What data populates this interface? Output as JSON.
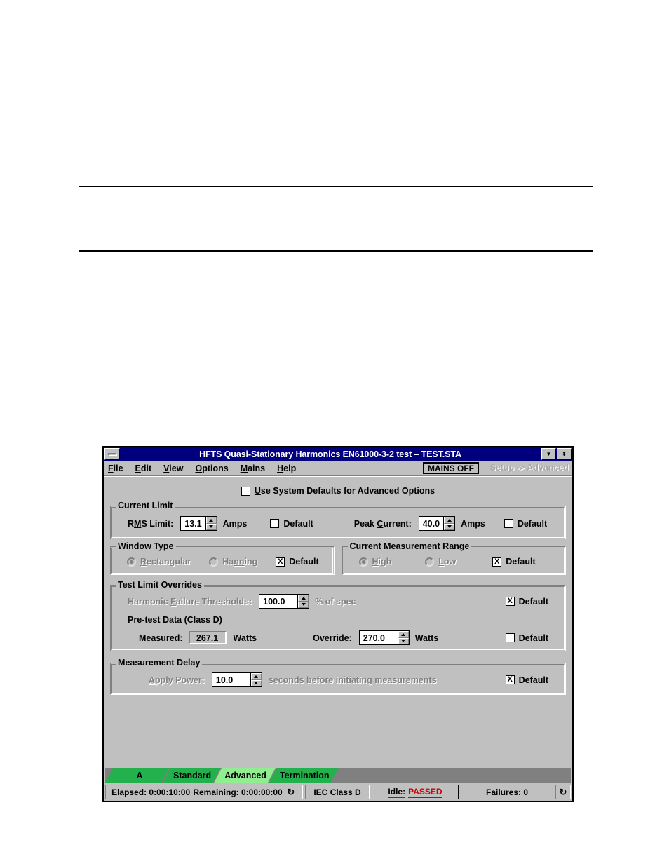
{
  "window": {
    "title": "HFTS Quasi-Stationary Harmonics EN61000-3-2 test – TEST.STA",
    "sysmenu_icon": "system-menu-icon",
    "minimize_icon": "▼",
    "restore_icon": "⬍"
  },
  "menubar": {
    "items": [
      {
        "label": "File",
        "accel": "F"
      },
      {
        "label": "Edit",
        "accel": "E"
      },
      {
        "label": "View",
        "accel": "V"
      },
      {
        "label": "Options",
        "accel": "O"
      },
      {
        "label": "Mains",
        "accel": "M"
      },
      {
        "label": "Help",
        "accel": "H"
      }
    ],
    "mains_button": "MAINS OFF",
    "breadcrumb": "Setup -> Advanced"
  },
  "system_defaults": {
    "label": "Use System Defaults for Advanced Options",
    "checked": false,
    "mark": ""
  },
  "current_limit": {
    "title": "Current Limit",
    "rms_label": "RMS Limit:",
    "rms_value": "13.1",
    "rms_unit": "Amps",
    "rms_default_label": "Default",
    "rms_default_mark": "",
    "peak_label": "Peak Current:",
    "peak_value": "40.0",
    "peak_unit": "Amps",
    "peak_default_label": "Default",
    "peak_default_mark": ""
  },
  "window_type": {
    "title": "Window Type",
    "option_rectangular": "Rectangular",
    "option_hanning": "Hanning",
    "selected": "Rectangular",
    "default_label": "Default",
    "default_mark": "X"
  },
  "current_measurement_range": {
    "title": "Current Measurement Range",
    "option_high": "High",
    "option_low": "Low",
    "selected": "High",
    "default_label": "Default",
    "default_mark": "X"
  },
  "test_limit_overrides": {
    "title": "Test Limit Overrides",
    "threshold_label": "Harmonic Failure Thresholds:",
    "threshold_value": "100.0",
    "threshold_unit": "% of spec",
    "threshold_default_label": "Default",
    "threshold_default_mark": "X",
    "pretest_heading": "Pre-test Data (Class D)",
    "measured_label": "Measured:",
    "measured_value": "267.1",
    "measured_unit": "Watts",
    "override_label": "Override:",
    "override_value": "270.0",
    "override_unit": "Watts",
    "override_default_label": "Default",
    "override_default_mark": ""
  },
  "measurement_delay": {
    "title": "Measurement Delay",
    "apply_power_label": "Apply Power:",
    "apply_power_value": "10.0",
    "suffix": "seconds before initiating measurements",
    "default_label": "Default",
    "default_mark": "X"
  },
  "tabs": [
    {
      "label": "A",
      "active": false
    },
    {
      "label": "Standard",
      "active": false
    },
    {
      "label": "Advanced",
      "active": true
    },
    {
      "label": "Termination",
      "active": false
    }
  ],
  "statusbar": {
    "elapsed": "Elapsed: 0:00:10:00",
    "remaining": "Remaining: 0:00:00:00",
    "refresh_icon": "↻",
    "iec_class": "IEC Class D",
    "state_label": "Idle:",
    "state_result": "PASSED",
    "failures": "Failures: 0",
    "refresh_icon2": "↻"
  },
  "colors": {
    "titlebar": "#00007f",
    "face": "#c0c0c0",
    "tab_inactive": "#22b14c",
    "tab_active": "#90ee90",
    "fail_red": "#d00000"
  }
}
